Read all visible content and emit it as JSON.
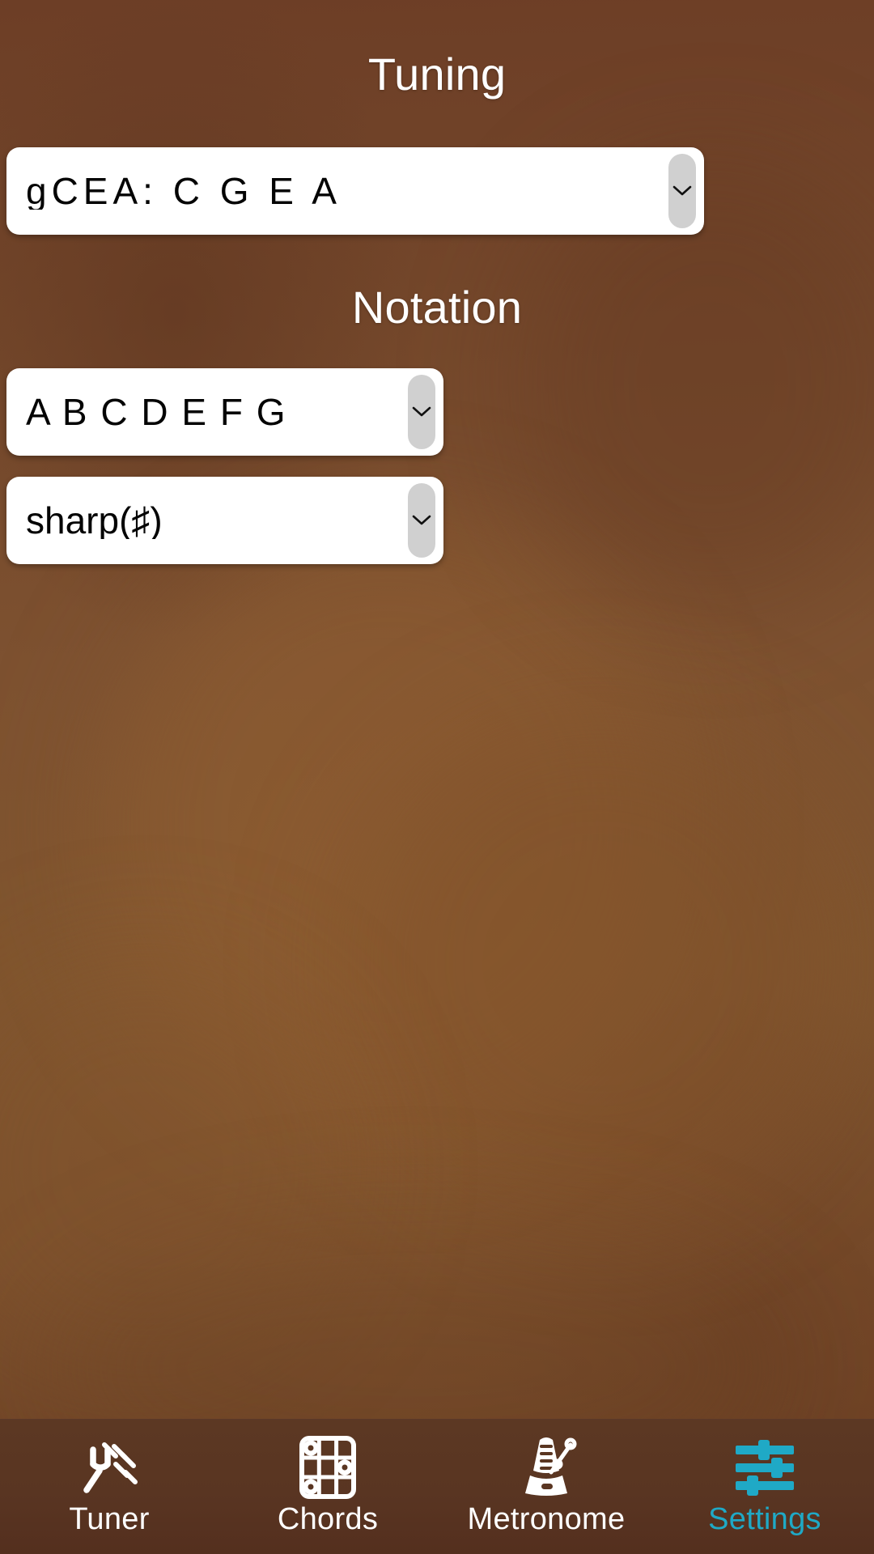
{
  "theme": {
    "background_brown_top": "#6d3e26",
    "background_brown_mid": "#80552e",
    "nav_background": "#5a3622",
    "accent_cyan": "#1fa9c6",
    "select_background": "#ffffff",
    "select_text": "#040404",
    "arrow_pill": "#d0d0d0",
    "heading_text": "#ffffff"
  },
  "sections": {
    "tuning": {
      "title": "Tuning",
      "select": {
        "value": "gCEA:  C  G  E  A",
        "icon": "chevron-down-icon"
      }
    },
    "notation": {
      "title": "Notation",
      "letters_select": {
        "value": "A B C D E F G",
        "icon": "chevron-down-icon"
      },
      "accidental_select": {
        "value": "sharp(♯)",
        "icon": "chevron-down-icon"
      }
    }
  },
  "bottom_nav": {
    "items": [
      {
        "label": "Tuner",
        "icon": "tuning-fork-icon",
        "active": false
      },
      {
        "label": "Chords",
        "icon": "chord-grid-icon",
        "active": false
      },
      {
        "label": "Metronome",
        "icon": "metronome-icon",
        "active": false
      },
      {
        "label": "Settings",
        "icon": "sliders-icon",
        "active": true
      }
    ]
  }
}
